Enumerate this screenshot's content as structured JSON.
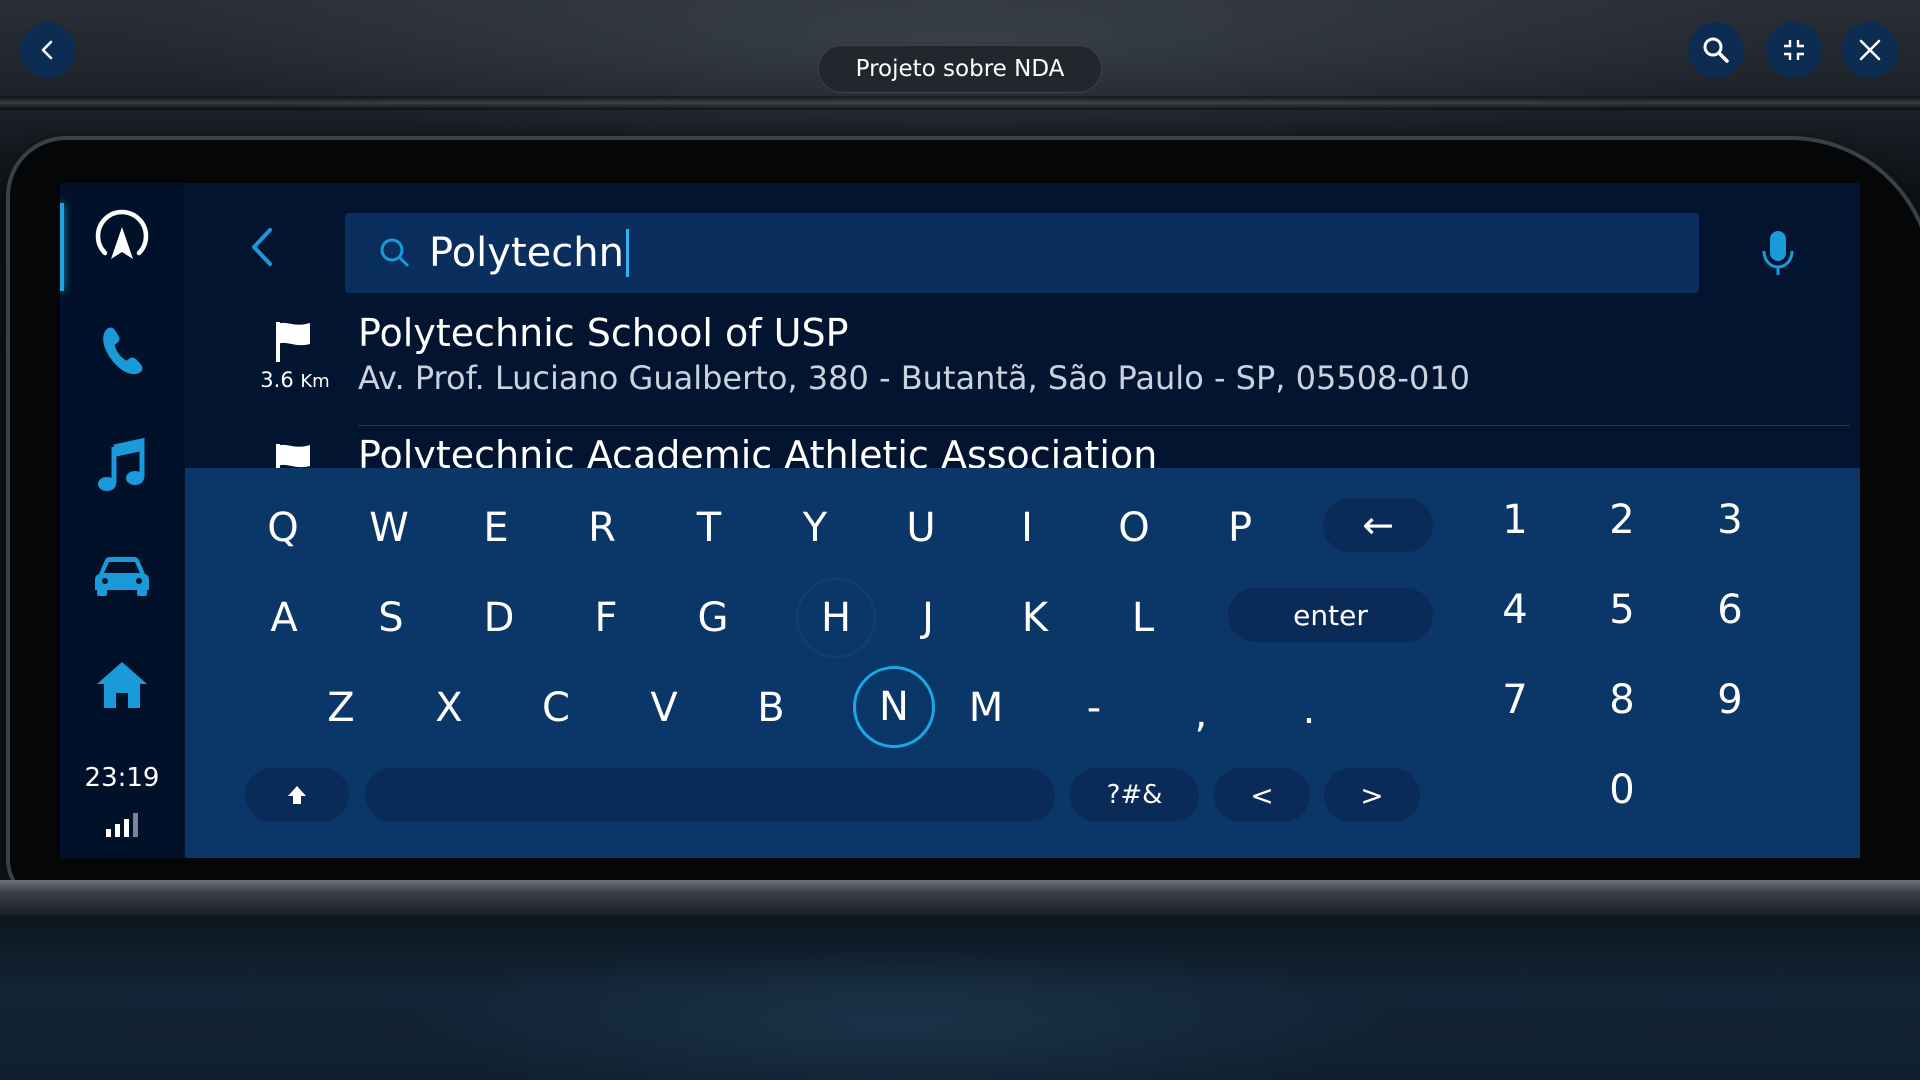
{
  "window": {
    "title": "Projeto sobre NDA"
  },
  "top_controls": [
    "back",
    "zoom",
    "collapse",
    "close"
  ],
  "rail": {
    "items": [
      "navigation",
      "phone",
      "media",
      "vehicle",
      "home"
    ],
    "clock": "23:19",
    "signal_bars": 4
  },
  "search": {
    "query": "Polytechn"
  },
  "results": [
    {
      "name": "Polytechnic School of USP",
      "address": "Av. Prof. Luciano Gualberto, 380 - Butantã, São Paulo - SP, 05508-010",
      "distance": "3.6",
      "unit": "Km"
    },
    {
      "name": "Polytechnic Academic Athletic Association",
      "address": "",
      "distance": "",
      "unit": ""
    }
  ],
  "keyboard": {
    "row1": [
      "Q",
      "W",
      "E",
      "R",
      "T",
      "Y",
      "U",
      "I",
      "O",
      "P"
    ],
    "backspace": "←",
    "row2": [
      "A",
      "S",
      "D",
      "F",
      "G",
      "H",
      "J",
      "K",
      "L"
    ],
    "enter": "enter",
    "row3": [
      "Z",
      "X",
      "C",
      "V",
      "B",
      "N",
      "M",
      "-",
      ",",
      "."
    ],
    "symbols": "?#&",
    "left": "<",
    "right": ">",
    "highlighted_key": "N",
    "hover_key": "H",
    "numpad": [
      "1",
      "2",
      "3",
      "4",
      "5",
      "6",
      "7",
      "8",
      "9",
      "0"
    ]
  },
  "colors": {
    "screen_bg": "#021430",
    "keyboard_bg": "#0b3768",
    "search_bg": "#0a2f5f",
    "accent": "#19a8e8",
    "button_bg": "#0c2c52"
  }
}
